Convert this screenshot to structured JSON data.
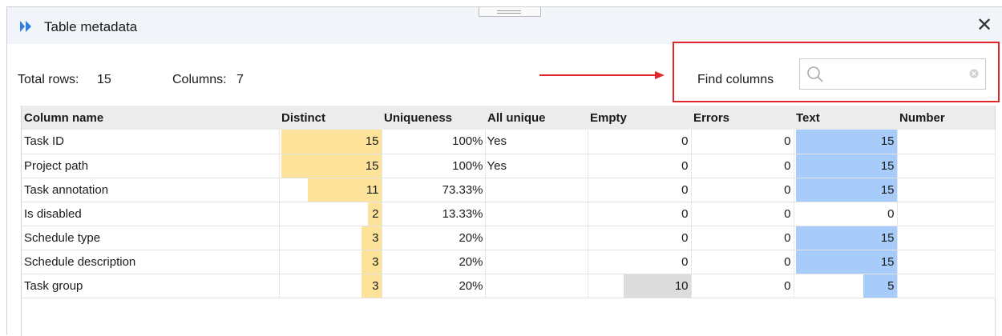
{
  "window": {
    "title": "Table metadata",
    "close_glyph": "✕"
  },
  "summary": {
    "total_rows_label": "Total rows:",
    "total_rows": 15,
    "columns_label": "Columns:",
    "columns": 7
  },
  "search": {
    "label": "Find columns",
    "value": "",
    "placeholder": ""
  },
  "annotation": {
    "box_color": "#e0262a",
    "arrow_color": "#e0262a"
  },
  "colors": {
    "distinct_bar": "#fde39a",
    "empty_bar": "#dcdcdc",
    "text_bar": "#a8ccfa"
  },
  "table": {
    "headers": [
      "Column name",
      "Distinct",
      "Uniqueness",
      "All unique",
      "Empty",
      "Errors",
      "Text",
      "Number"
    ],
    "rows": [
      {
        "name": "Task ID",
        "distinct": 15,
        "uniqueness": "100%",
        "all_unique": "Yes",
        "empty": 0,
        "errors": 0,
        "text": 15,
        "number": ""
      },
      {
        "name": "Project path",
        "distinct": 15,
        "uniqueness": "100%",
        "all_unique": "Yes",
        "empty": 0,
        "errors": 0,
        "text": 15,
        "number": ""
      },
      {
        "name": "Task annotation",
        "distinct": 11,
        "uniqueness": "73.33%",
        "all_unique": "",
        "empty": 0,
        "errors": 0,
        "text": 15,
        "number": ""
      },
      {
        "name": "Is disabled",
        "distinct": 2,
        "uniqueness": "13.33%",
        "all_unique": "",
        "empty": 0,
        "errors": 0,
        "text": 0,
        "number": ""
      },
      {
        "name": "Schedule type",
        "distinct": 3,
        "uniqueness": "20%",
        "all_unique": "",
        "empty": 0,
        "errors": 0,
        "text": 15,
        "number": ""
      },
      {
        "name": "Schedule description",
        "distinct": 3,
        "uniqueness": "20%",
        "all_unique": "",
        "empty": 0,
        "errors": 0,
        "text": 15,
        "number": ""
      },
      {
        "name": "Task group",
        "distinct": 3,
        "uniqueness": "20%",
        "all_unique": "",
        "empty": 10,
        "errors": 0,
        "text": 5,
        "number": ""
      }
    ]
  }
}
